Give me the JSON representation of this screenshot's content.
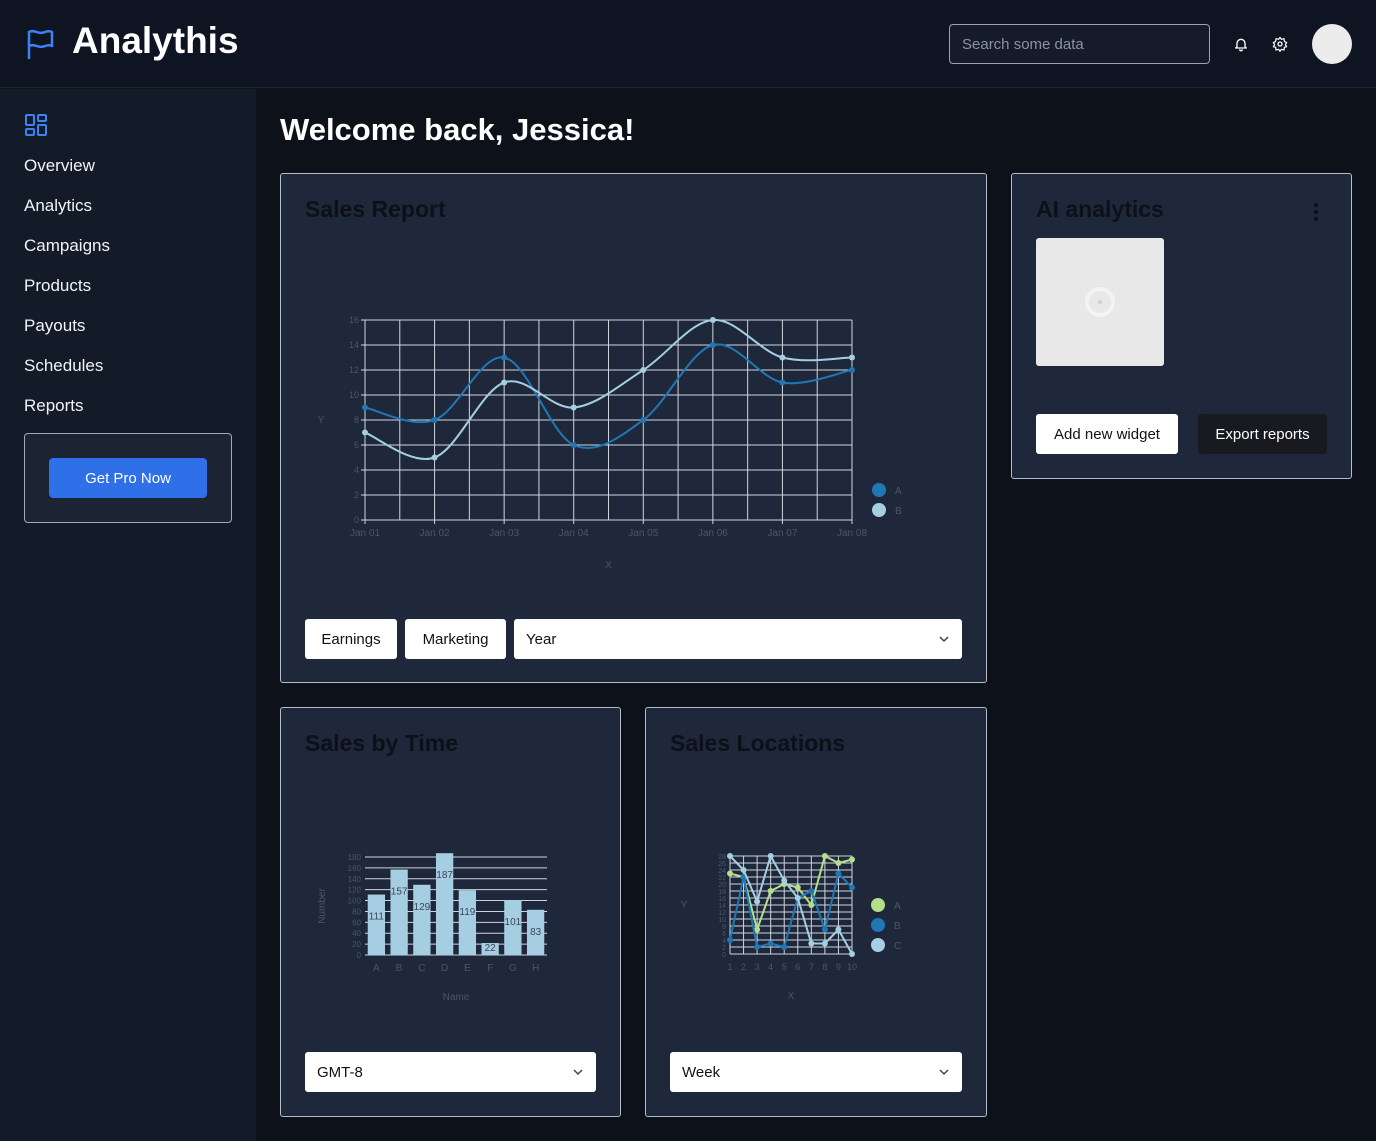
{
  "header": {
    "app_title": "Analythis",
    "search_placeholder": "Search some data"
  },
  "sidebar": {
    "items": [
      {
        "label": "Overview"
      },
      {
        "label": "Analytics"
      },
      {
        "label": "Campaigns"
      },
      {
        "label": "Products"
      },
      {
        "label": "Payouts"
      },
      {
        "label": "Schedules"
      },
      {
        "label": "Reports"
      }
    ],
    "pro_button": "Get Pro Now"
  },
  "main": {
    "welcome": "Welcome back, Jessica!",
    "sales_report": {
      "title": "Sales Report",
      "buttons": [
        "Earnings",
        "Marketing"
      ],
      "period_select": "Year"
    },
    "ai_analytics": {
      "title": "AI analytics",
      "add_widget": "Add new widget",
      "export": "Export reports"
    },
    "sales_by_time": {
      "title": "Sales by Time",
      "timezone_select": "GMT-8"
    },
    "sales_locations": {
      "title": "Sales Locations",
      "range_select": "Week"
    }
  },
  "colors": {
    "accent": "#2f6fe8",
    "series_dark": "#1f77b4",
    "series_light": "#a6cee3",
    "series_green": "#b2df8a"
  },
  "chart_data": [
    {
      "type": "line",
      "title": "",
      "xlabel": "X",
      "ylabel": "Y",
      "x": [
        "Jan 01",
        "Jan 02",
        "Jan 03",
        "Jan 04",
        "Jan 05",
        "Jan 06",
        "Jan 07",
        "Jan 08"
      ],
      "ylim": [
        0,
        16
      ],
      "yticks": [
        0,
        2,
        4,
        6,
        8,
        10,
        12,
        14,
        16
      ],
      "grid": true,
      "legend": "right",
      "series": [
        {
          "name": "A",
          "values": [
            9,
            8,
            13,
            6,
            8,
            14,
            11,
            12
          ]
        },
        {
          "name": "B",
          "values": [
            7,
            5,
            11,
            9,
            12,
            16,
            13,
            13
          ]
        }
      ]
    },
    {
      "type": "bar",
      "title": "",
      "xlabel": "Name",
      "ylabel": "Number",
      "categories": [
        "A",
        "B",
        "C",
        "D",
        "E",
        "F",
        "G",
        "H"
      ],
      "values": [
        111,
        157,
        129,
        187,
        119,
        22,
        101,
        83
      ],
      "ylim": [
        0,
        180
      ],
      "yticks": [
        0,
        20,
        40,
        60,
        80,
        100,
        120,
        140,
        160,
        180
      ],
      "grid": true
    },
    {
      "type": "line",
      "title": "",
      "xlabel": "X",
      "ylabel": "Y",
      "x": [
        1,
        2,
        3,
        4,
        5,
        6,
        7,
        8,
        9,
        10
      ],
      "ylim": [
        0,
        28
      ],
      "yticks": [
        0,
        2,
        4,
        6,
        8,
        10,
        12,
        14,
        16,
        18,
        20,
        22,
        24,
        26,
        28
      ],
      "grid": true,
      "legend": "right",
      "series": [
        {
          "name": "A",
          "values": [
            23,
            22,
            7,
            18,
            20,
            19,
            14,
            28,
            26,
            27
          ]
        },
        {
          "name": "B",
          "values": [
            4,
            22,
            2,
            3,
            2,
            16,
            18,
            7,
            23,
            19
          ]
        },
        {
          "name": "C",
          "values": [
            28,
            24,
            15,
            29,
            21,
            16,
            3,
            3,
            7,
            0
          ]
        }
      ]
    }
  ]
}
